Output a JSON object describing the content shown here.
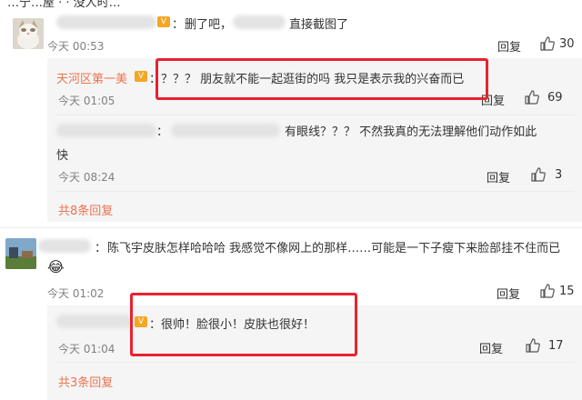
{
  "top_fragment": "…宁…屋 · · 没人时…",
  "comment1": {
    "sep": "：",
    "text": "删了吧，",
    "text2": "直接截图了",
    "time": "今天 00:53",
    "reply": "回复",
    "likes": "30"
  },
  "reply1": {
    "author": "天河区第一美",
    "text": "：？？？ 朋友就不能一起逛街的吗 我只是表示我的兴奋而已",
    "time": "今天 01:05",
    "reply": "回复",
    "likes": "69"
  },
  "reply2": {
    "text_line1": "有眼线？？？ 不然我真的无法理解他们动作如此",
    "text_line2": "快",
    "time": "今天 08:24",
    "reply": "回复",
    "likes": "3"
  },
  "more1": "共8条回复",
  "comment2": {
    "text": "陈飞宇皮肤怎样哈哈哈 我感觉不像网上的那样……可能是一下子瘦下来脸部挂不住而已",
    "emoji": "😂",
    "time": "今天 01:02",
    "reply": "回复",
    "likes": "15"
  },
  "reply3": {
    "text": "：很帅！脸很小！皮肤也很好！",
    "time": "今天 01:04",
    "reply": "回复",
    "likes": "17"
  },
  "more2": "共3条回复",
  "colors": {
    "accent": "#eb7350",
    "highlight": "#e8222f",
    "sub_bg": "#f5f5f5"
  },
  "icons": {
    "like": "thumbs-up-icon",
    "vip": "vip-badge-icon"
  }
}
